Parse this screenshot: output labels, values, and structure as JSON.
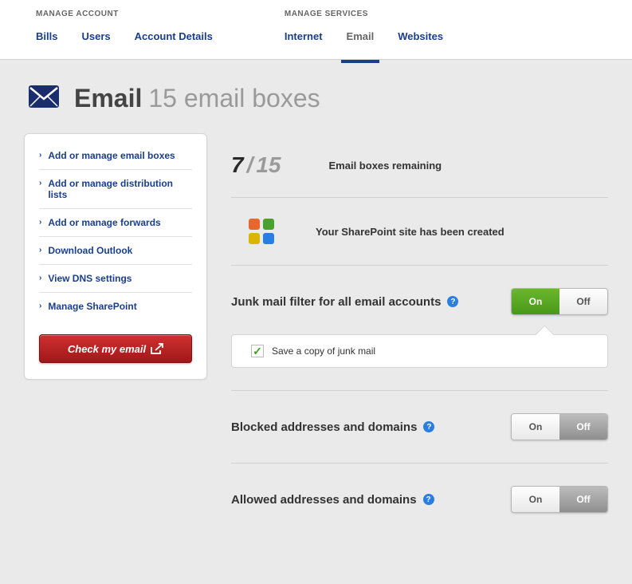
{
  "nav": {
    "account_label": "MANAGE ACCOUNT",
    "services_label": "MANAGE SERVICES",
    "account_tabs": [
      "Bills",
      "Users",
      "Account Details"
    ],
    "service_tabs": [
      "Internet",
      "Email",
      "Websites"
    ],
    "active_service": "Email"
  },
  "header": {
    "title": "Email",
    "subtitle": "15 email boxes"
  },
  "sidebar": {
    "items": [
      "Add or manage email boxes",
      "Add or manage distribution lists",
      "Add or manage forwards",
      "Download Outlook",
      "View DNS settings",
      "Manage SharePoint"
    ],
    "check_email_label": "Check my email"
  },
  "stats": {
    "used": "7",
    "total": "15",
    "label": "Email boxes remaining"
  },
  "sharepoint": {
    "message": "Your SharePoint site has been created"
  },
  "sections": {
    "junk": {
      "title": "Junk mail filter for all email accounts",
      "state": "on",
      "checkbox_label": "Save a copy of junk mail",
      "checkbox_checked": true
    },
    "blocked": {
      "title": "Blocked addresses and domains",
      "state": "off"
    },
    "allowed": {
      "title": "Allowed addresses and domains",
      "state": "off"
    }
  },
  "toggle_labels": {
    "on": "On",
    "off": "Off"
  }
}
